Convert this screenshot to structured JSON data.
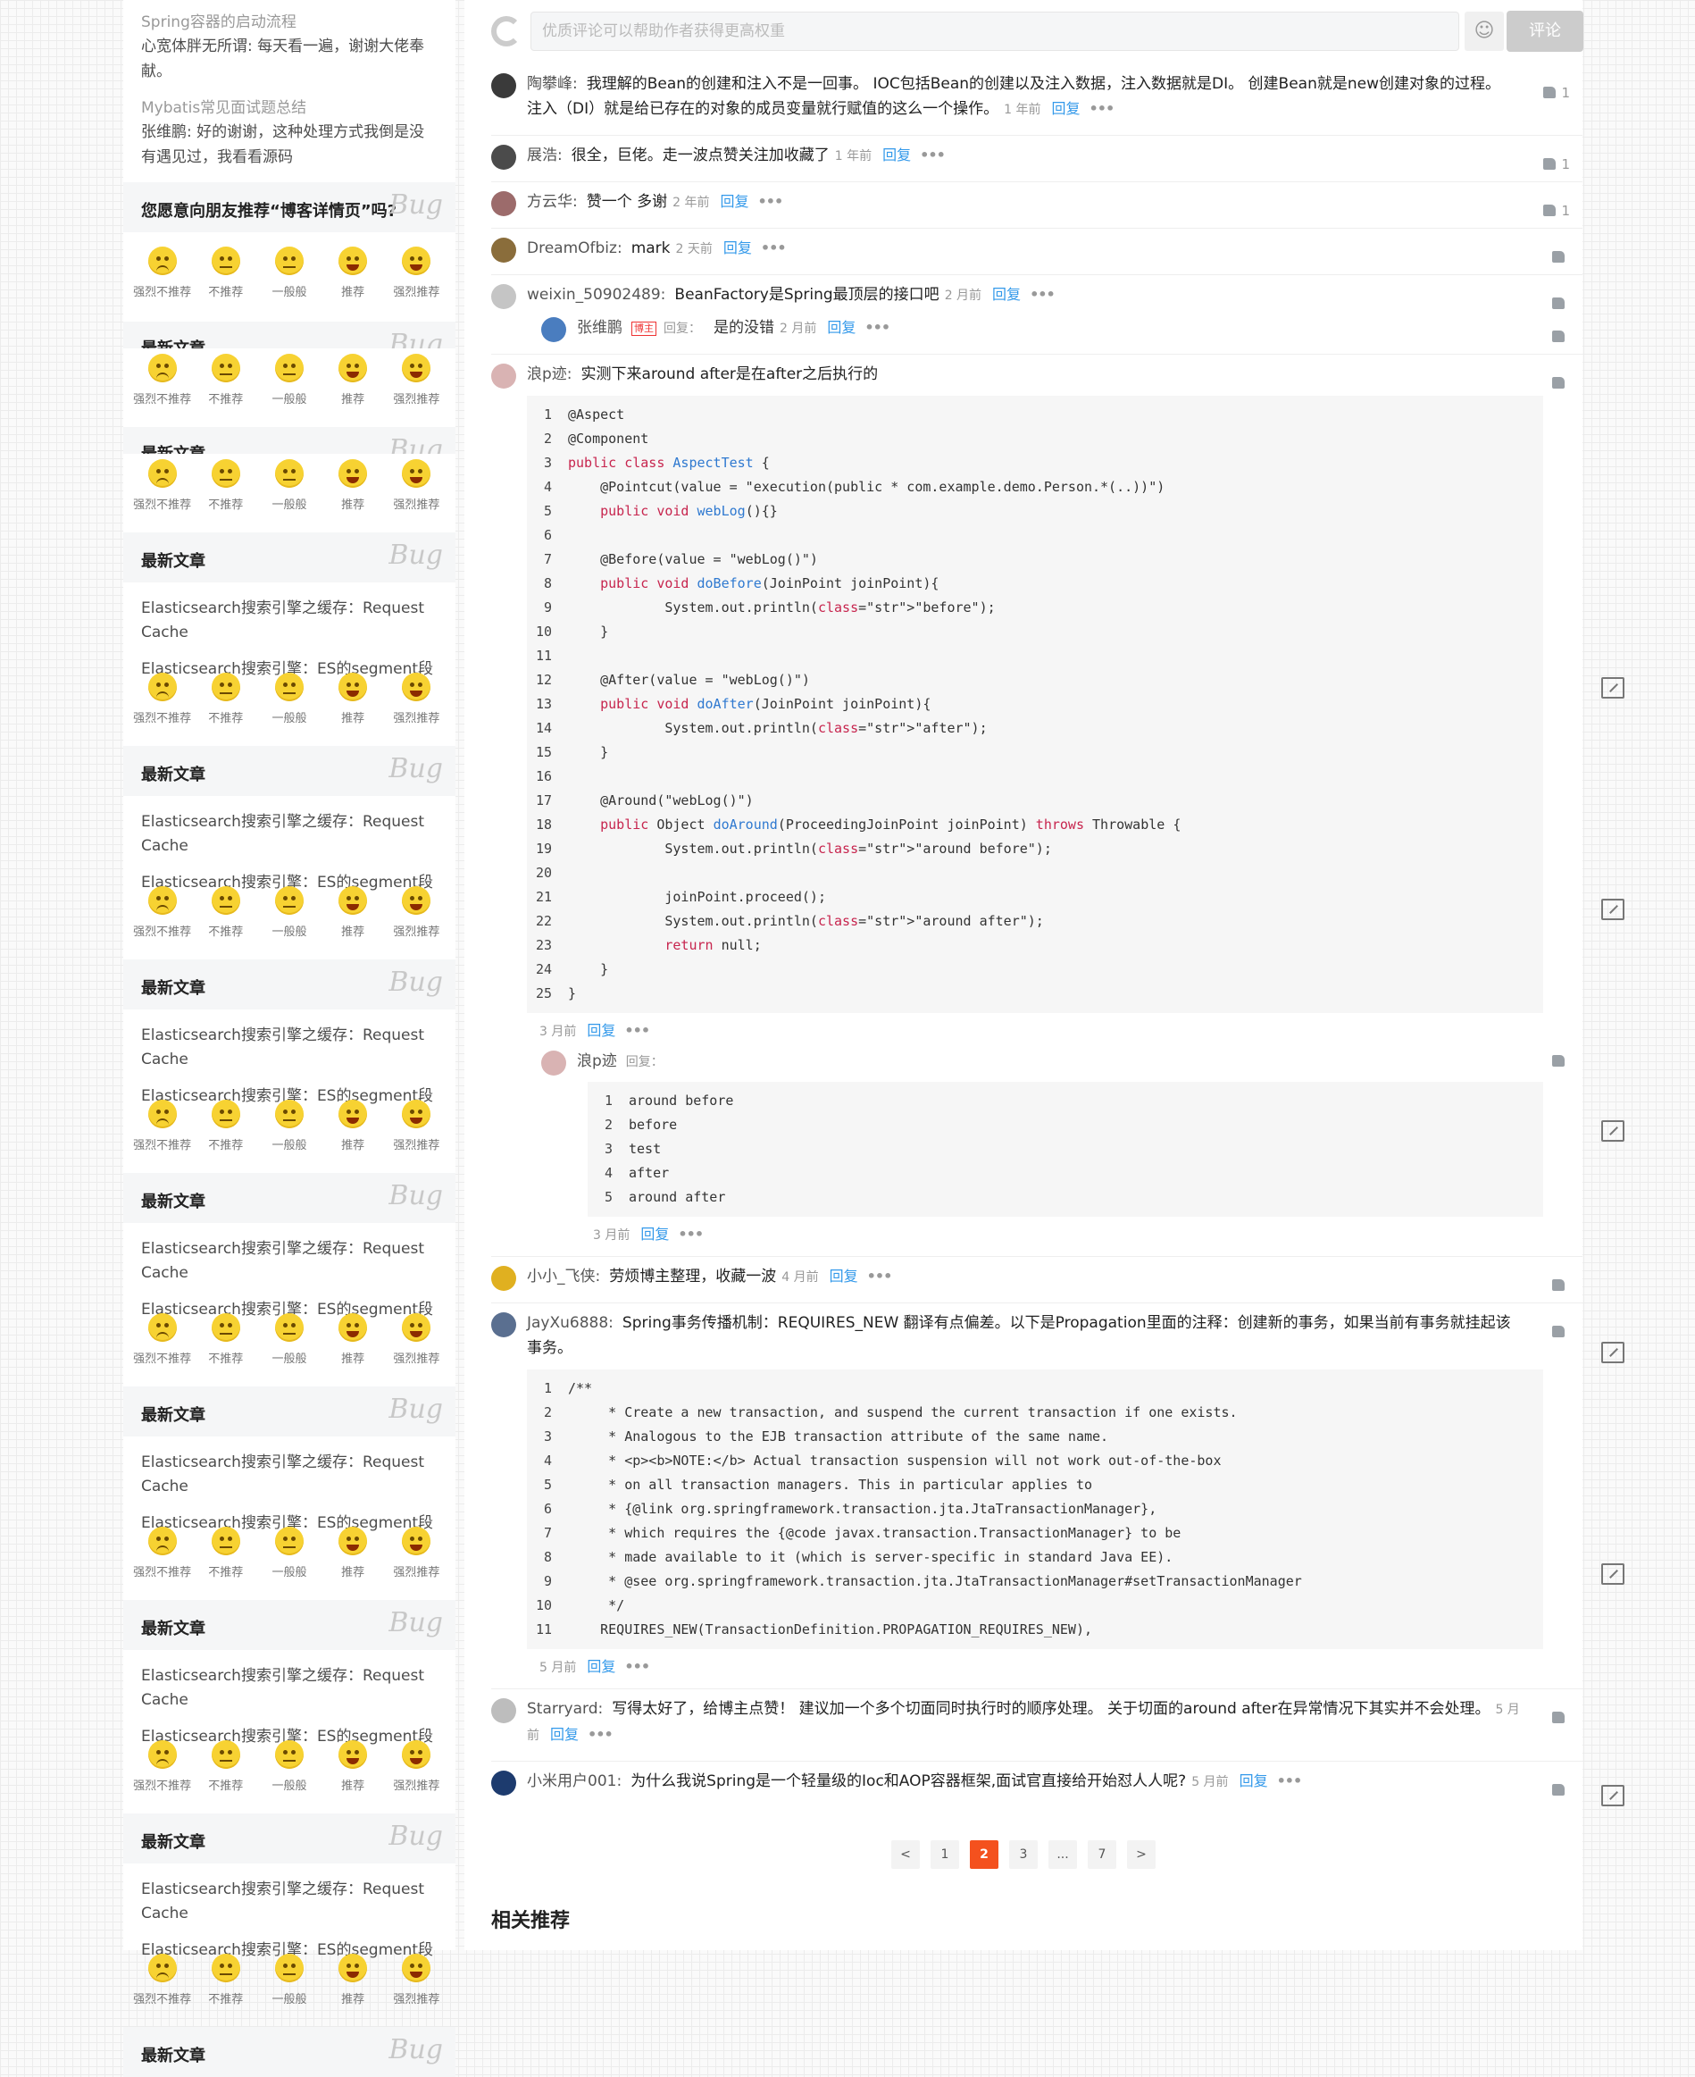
{
  "sidebar": {
    "top_link1": "Spring容器的启动流程",
    "top_comment1": "心宽体胖无所谓: 每天看一遍，谢谢大佬奉献。",
    "top_link2": "Mybatis常见面试题总结",
    "top_comment2": "张维鹏: 好的谢谢，这种处理方式我倒是没有遇见过，我看看源码",
    "recommend_title": "您愿意向朋友推荐“博客详情页”吗?",
    "bug_text": "Bug",
    "latest_title": "最新文章",
    "face_labels": [
      "强烈不推荐",
      "不推荐",
      "一般般",
      "推荐",
      "强烈推荐"
    ],
    "article1": "Elasticsearch搜索引擎之缓存：Request Cache",
    "article2": "Elasticsearch搜索引擎：ES的segment段合"
  },
  "comment_box": {
    "placeholder": "优质评论可以帮助作者获得更高权重",
    "emoji": "☺",
    "submit": "评论"
  },
  "comments": [
    {
      "name": "陶攀峰:",
      "text": "我理解的Bean的创建和注入不是一回事。 IOC包括Bean的创建以及注入数据，注入数据就是DI。 创建Bean就是new创建对象的过程。 注入（DI）就是给已存在的对象的成员变量就行赋值的这么一个操作。",
      "time": "1 年前",
      "likes": "1",
      "avatar": "#3a3a3a"
    },
    {
      "name": "展浩:",
      "text": "很全，巨佬。走一波点赞关注加收藏了",
      "time": "1 年前",
      "likes": "1",
      "avatar": "#4b4b4b"
    },
    {
      "name": "方云华:",
      "text": "赞一个 多谢",
      "time": "2 年前",
      "likes": "1",
      "avatar": "#9c6b6b"
    },
    {
      "name": "DreamOfbiz:",
      "text": "mark",
      "time": "2 天前",
      "likes": "",
      "avatar": "#8a6d3b"
    },
    {
      "name": "weixin_50902489:",
      "text": "BeanFactory是Spring最顶层的接口吧",
      "time": "2 月前",
      "likes": "",
      "avatar": "#c5c5c5"
    },
    {
      "name": "浪p迹:",
      "text": "实测下来around after是在after之后执行的",
      "time": "3 月前",
      "likes": "",
      "avatar": "#d9b3b3"
    },
    {
      "name": "小小_飞侠:",
      "text": "劳烦博主整理，收藏一波",
      "time": "4 月前",
      "likes": "",
      "avatar": "#e0b020"
    },
    {
      "name": "JayXu6888:",
      "text": "Spring事务传播机制：REQUIRES_NEW 翻译有点偏差。以下是Propagation里面的注释：创建新的事务，如果当前有事务就挂起该事务。",
      "time": "5 月前",
      "likes": "",
      "avatar": "#5a6f90"
    },
    {
      "name": "Starryard:",
      "text": "写得太好了，给博主点赞！ 建议加一个多个切面同时执行时的顺序处理。 关于切面的around after在异常情况下其实并不会处理。",
      "time": "5 月前",
      "likes": "",
      "avatar": "#bdbdbd"
    },
    {
      "name": "小米用户001:",
      "text": "为什么我说Spring是一个轻量级的Ioc和AOP容器框架,面试官直接给开始怼人人呢?",
      "time": "5 月前",
      "likes": "",
      "avatar": "#1d3b6e"
    }
  ],
  "labels": {
    "reply": "回复",
    "more": "•••",
    "reply_tag": "回复：",
    "badge": "博主"
  },
  "reply1": {
    "name": "张维鹏",
    "text": "是的没错",
    "time": "2 月前"
  },
  "reply2": {
    "name": "浪p迹"
  },
  "reply2_time": "3 月前",
  "code1": [
    {
      "n": "1",
      "t": "@Aspect"
    },
    {
      "n": "2",
      "t": "@Component"
    },
    {
      "n": "3",
      "t": "public class AspectTest {"
    },
    {
      "n": "4",
      "t": "    @Pointcut(value = \"execution(public * com.example.demo.Person.*(..))\")"
    },
    {
      "n": "5",
      "t": "    public void webLog(){}"
    },
    {
      "n": "6",
      "t": ""
    },
    {
      "n": "7",
      "t": "    @Before(value = \"webLog()\")"
    },
    {
      "n": "8",
      "t": "    public void doBefore(JoinPoint joinPoint){"
    },
    {
      "n": "9",
      "t": "            System.out.println(\"before\");"
    },
    {
      "n": "10",
      "t": "    }"
    },
    {
      "n": "11",
      "t": ""
    },
    {
      "n": "12",
      "t": "    @After(value = \"webLog()\")"
    },
    {
      "n": "13",
      "t": "    public void doAfter(JoinPoint joinPoint){"
    },
    {
      "n": "14",
      "t": "            System.out.println(\"after\");"
    },
    {
      "n": "15",
      "t": "    }"
    },
    {
      "n": "16",
      "t": ""
    },
    {
      "n": "17",
      "t": "    @Around(\"webLog()\")"
    },
    {
      "n": "18",
      "t": "    public Object doAround(ProceedingJoinPoint joinPoint) throws Throwable {"
    },
    {
      "n": "19",
      "t": "            System.out.println(\"around before\");"
    },
    {
      "n": "20",
      "t": ""
    },
    {
      "n": "21",
      "t": "            joinPoint.proceed();"
    },
    {
      "n": "22",
      "t": "            System.out.println(\"around after\");"
    },
    {
      "n": "23",
      "t": "            return null;"
    },
    {
      "n": "24",
      "t": "    }"
    },
    {
      "n": "25",
      "t": "}"
    }
  ],
  "code2": [
    {
      "n": "1",
      "t": "around before"
    },
    {
      "n": "2",
      "t": "before"
    },
    {
      "n": "3",
      "t": "test"
    },
    {
      "n": "4",
      "t": "after"
    },
    {
      "n": "5",
      "t": "around after"
    }
  ],
  "code3": [
    {
      "n": "1",
      "t": "/**"
    },
    {
      "n": "2",
      "t": "     * Create a new transaction, and suspend the current transaction if one exists."
    },
    {
      "n": "3",
      "t": "     * Analogous to the EJB transaction attribute of the same name."
    },
    {
      "n": "4",
      "t": "     * <p><b>NOTE:</b> Actual transaction suspension will not work out-of-the-box"
    },
    {
      "n": "5",
      "t": "     * on all transaction managers. This in particular applies to"
    },
    {
      "n": "6",
      "t": "     * {@link org.springframework.transaction.jta.JtaTransactionManager},"
    },
    {
      "n": "7",
      "t": "     * which requires the {@code javax.transaction.TransactionManager} to be"
    },
    {
      "n": "8",
      "t": "     * made available to it (which is server-specific in standard Java EE)."
    },
    {
      "n": "9",
      "t": "     * @see org.springframework.transaction.jta.JtaTransactionManager#setTransactionManager"
    },
    {
      "n": "10",
      "t": "     */"
    },
    {
      "n": "11",
      "t": "    REQUIRES_NEW(TransactionDefinition.PROPAGATION_REQUIRES_NEW),"
    }
  ],
  "pager": [
    "<",
    "1",
    "2",
    "3",
    "...",
    "7",
    ">"
  ],
  "pager_active": "2",
  "related_title": "相关推荐"
}
